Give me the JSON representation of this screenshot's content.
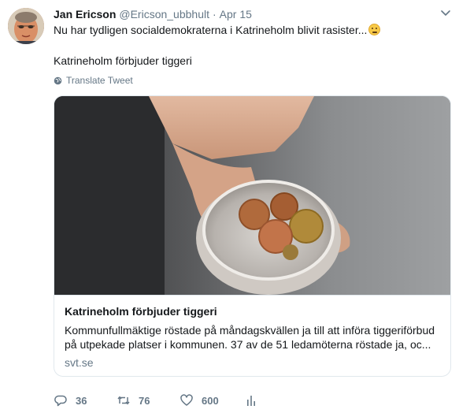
{
  "tweet": {
    "author_name": "Jan Ericson",
    "author_handle": "@Ericson_ubbhult",
    "separator": "·",
    "date": "Apr 15",
    "text_line1": "Nu har tydligen socialdemokraterna i Katrineholm blivit rasister...",
    "text_line2": "Katrineholm förbjuder tiggeri",
    "emoji": "thinking-face-emoji",
    "translate_label": "Translate Tweet"
  },
  "card": {
    "title": "Katrineholm förbjuder tiggeri",
    "description_line1": "Kommunfullmäktige röstade på måndagskvällen ja till att införa tiggeriförbud",
    "description_line2": "på utpekade platser i kommunen. 37 av de 51 ledamöterna röstade ja, oc...",
    "domain": "svt.se",
    "image": "hand-holding-cup-with-coins"
  },
  "actions": {
    "replies": "36",
    "retweets": "76",
    "likes": "600"
  },
  "icons": {
    "reply": "reply-icon",
    "retweet": "retweet-icon",
    "like": "heart-icon",
    "analytics": "analytics-icon",
    "more": "chevron-down-icon",
    "translate": "globe-icon"
  },
  "colors": {
    "text": "#14171a",
    "secondary": "#657786",
    "border": "#e1e8ed"
  }
}
